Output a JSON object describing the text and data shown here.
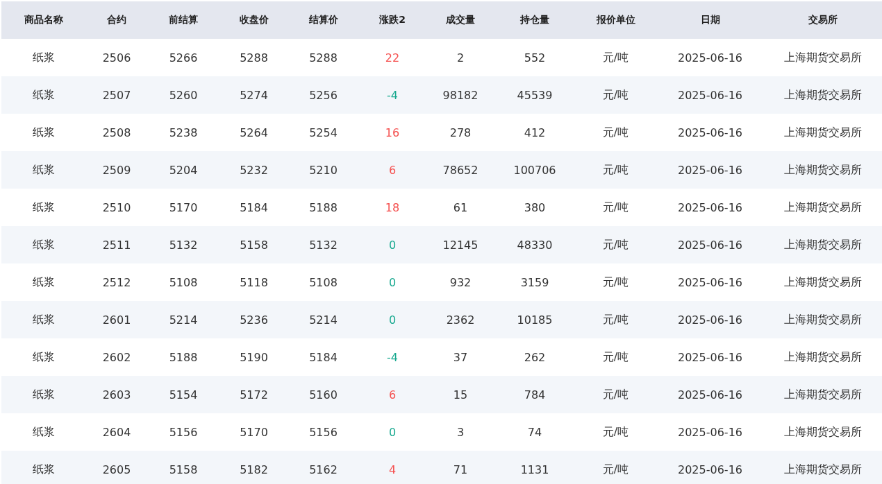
{
  "table": {
    "columns": [
      "商品名称",
      "合约",
      "前结算",
      "收盘价",
      "结算价",
      "涨跌2",
      "成交量",
      "持仓量",
      "报价单位",
      "日期",
      "交易所"
    ],
    "rows": [
      {
        "cells": [
          "纸浆",
          "2506",
          "5266",
          "5288",
          "5288",
          "22",
          "2",
          "552",
          "元/吨",
          "2025-06-16",
          "上海期货交易所"
        ],
        "color": "#f5504f"
      },
      {
        "cells": [
          "纸浆",
          "2507",
          "5260",
          "5274",
          "5256",
          "-4",
          "98182",
          "45539",
          "元/吨",
          "2025-06-16",
          "上海期货交易所"
        ],
        "color": "#16a88e"
      },
      {
        "cells": [
          "纸浆",
          "2508",
          "5238",
          "5264",
          "5254",
          "16",
          "278",
          "412",
          "元/吨",
          "2025-06-16",
          "上海期货交易所"
        ],
        "color": "#f5504f"
      },
      {
        "cells": [
          "纸浆",
          "2509",
          "5204",
          "5232",
          "5210",
          "6",
          "78652",
          "100706",
          "元/吨",
          "2025-06-16",
          "上海期货交易所"
        ],
        "color": "#f5504f"
      },
      {
        "cells": [
          "纸浆",
          "2510",
          "5170",
          "5184",
          "5188",
          "18",
          "61",
          "380",
          "元/吨",
          "2025-06-16",
          "上海期货交易所"
        ],
        "color": "#f5504f"
      },
      {
        "cells": [
          "纸浆",
          "2511",
          "5132",
          "5158",
          "5132",
          "0",
          "12145",
          "48330",
          "元/吨",
          "2025-06-16",
          "上海期货交易所"
        ],
        "color": "#16a88e"
      },
      {
        "cells": [
          "纸浆",
          "2512",
          "5108",
          "5118",
          "5108",
          "0",
          "932",
          "3159",
          "元/吨",
          "2025-06-16",
          "上海期货交易所"
        ],
        "color": "#16a88e"
      },
      {
        "cells": [
          "纸浆",
          "2601",
          "5214",
          "5236",
          "5214",
          "0",
          "2362",
          "10185",
          "元/吨",
          "2025-06-16",
          "上海期货交易所"
        ],
        "color": "#16a88e"
      },
      {
        "cells": [
          "纸浆",
          "2602",
          "5188",
          "5190",
          "5184",
          "-4",
          "37",
          "262",
          "元/吨",
          "2025-06-16",
          "上海期货交易所"
        ],
        "color": "#16a88e"
      },
      {
        "cells": [
          "纸浆",
          "2603",
          "5154",
          "5172",
          "5160",
          "6",
          "15",
          "784",
          "元/吨",
          "2025-06-16",
          "上海期货交易所"
        ],
        "color": "#f5504f"
      },
      {
        "cells": [
          "纸浆",
          "2604",
          "5156",
          "5170",
          "5156",
          "0",
          "3",
          "74",
          "元/吨",
          "2025-06-16",
          "上海期货交易所"
        ],
        "color": "#16a88e"
      },
      {
        "cells": [
          "纸浆",
          "2605",
          "5158",
          "5182",
          "5162",
          "4",
          "71",
          "1131",
          "元/吨",
          "2025-06-16",
          "上海期货交易所"
        ],
        "color": "#f5504f"
      }
    ]
  }
}
